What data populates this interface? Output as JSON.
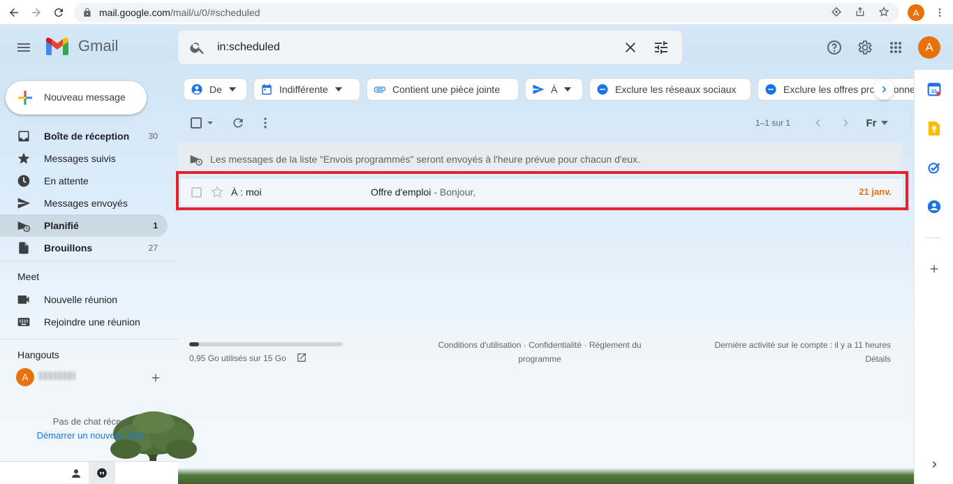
{
  "browser": {
    "url_host": "mail.google.com",
    "url_path": "/mail/u/0/#scheduled",
    "profile_initial": "A"
  },
  "header": {
    "app_name": "Gmail",
    "search_value": "in:scheduled",
    "avatar_initial": "A"
  },
  "compose": {
    "label": "Nouveau message"
  },
  "sidebar": {
    "items": [
      {
        "label": "Boîte de réception",
        "count": "30",
        "icon": "inbox-icon",
        "bold": true
      },
      {
        "label": "Messages suivis",
        "count": "",
        "icon": "star-icon",
        "bold": false
      },
      {
        "label": "En attente",
        "count": "",
        "icon": "clock-icon",
        "bold": false
      },
      {
        "label": "Messages envoyés",
        "count": "",
        "icon": "send-icon",
        "bold": false
      },
      {
        "label": "Planifié",
        "count": "1",
        "icon": "scheduled-send-icon",
        "bold": true,
        "active": true
      },
      {
        "label": "Brouillons",
        "count": "27",
        "icon": "draft-icon",
        "bold": true
      }
    ],
    "meet": {
      "title": "Meet",
      "items": [
        {
          "label": "Nouvelle réunion",
          "icon": "videocam-icon"
        },
        {
          "label": "Rejoindre une réunion",
          "icon": "keyboard-icon"
        }
      ]
    },
    "hangouts": {
      "title": "Hangouts",
      "avatar_initial": "A",
      "no_chat_text": "Pas de chat récent",
      "start_link": "Démarrer un nouveau chat"
    }
  },
  "filters": [
    {
      "label": "De",
      "icon": "person-icon",
      "dropdown": true
    },
    {
      "label": "Indifférente",
      "icon": "calendar-icon",
      "dropdown": true
    },
    {
      "label": "Contient une pièce jointe",
      "icon": "attachment-icon",
      "dropdown": false
    },
    {
      "label": "À",
      "icon": "send-icon",
      "dropdown": true
    },
    {
      "label": "Exclure les réseaux sociaux",
      "icon": "minus-circle-icon",
      "dropdown": false
    },
    {
      "label": "Exclure les offres promotionnelles",
      "icon": "minus-circle-icon",
      "dropdown": false
    }
  ],
  "toolbar": {
    "pager": "1–1 sur 1",
    "input_tools": "Fr"
  },
  "banner": {
    "text": "Les messages de la liste \"Envois programmés\" seront envoyés à l'heure prévue pour chacun d'eux."
  },
  "messages": [
    {
      "to": "À : moi",
      "subject": "Offre d'emploi",
      "snippet": " - Bonjour,",
      "date": "21 janv."
    }
  ],
  "footer": {
    "storage_text": "0,95 Go utilisés sur 15 Go",
    "storage_fraction": 0.063,
    "terms_line1": "Conditions d'utilisation · Confidentialité · Règlement du",
    "terms_line2": "programme",
    "activity_line1": "Dernière activité sur le compte : il y a 11 heures",
    "activity_line2": "Détails"
  },
  "colors": {
    "accent": "#1a73e8",
    "avatar": "#e8710a",
    "date": "#e37400",
    "highlight_box": "#e8202a"
  }
}
